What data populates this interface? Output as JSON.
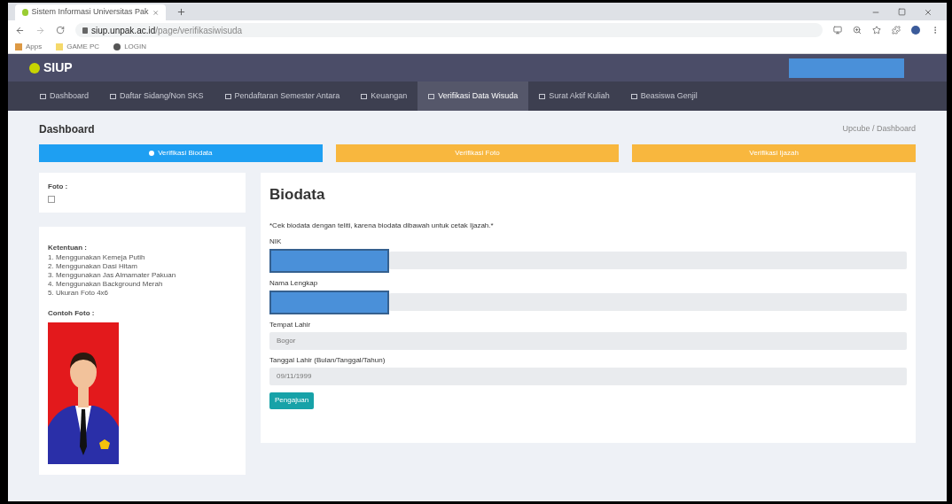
{
  "browser": {
    "tab_title": "Sistem Informasi Universitas Pak",
    "url_host": "siup.unpak.ac.id",
    "url_path": "/page/verifikasiwisuda",
    "bookmarks": [
      "Apps",
      "GAME PC",
      "LOGIN"
    ]
  },
  "app": {
    "logo": "SIUP",
    "user_redacted": true
  },
  "nav": [
    {
      "label": "Dashboard",
      "selected": false
    },
    {
      "label": "Daftar Sidang/Non SKS",
      "selected": false
    },
    {
      "label": "Pendaftaran Semester Antara",
      "selected": false
    },
    {
      "label": "Keuangan",
      "selected": false
    },
    {
      "label": "Verifikasi Data Wisuda",
      "selected": true
    },
    {
      "label": "Surat Aktif Kuliah",
      "selected": false
    },
    {
      "label": "Beasiswa Genjil",
      "selected": false
    }
  ],
  "page_title": "Dashboard",
  "breadcrumb": "Upcube / Dashboard",
  "steps": [
    {
      "label": "Verifikasi Biodata",
      "selected": true
    },
    {
      "label": "Verifikasi Foto",
      "selected": false
    },
    {
      "label": "Verifikasi Ijazah",
      "selected": false
    }
  ],
  "photo_card": {
    "label": "Foto :"
  },
  "rules": {
    "title": "Ketentuan :",
    "items": [
      "1. Menggunakan Kemeja Putih",
      "2. Menggunakan Dasi Hitam",
      "3. Menggunakan Jas Almamater Pakuan",
      "4. Menggunakan Background Merah",
      "5. Ukuran Foto 4x6"
    ],
    "example_label": "Contoh Foto :"
  },
  "form": {
    "title": "Biodata",
    "note": "*Cek biodata dengan teliti, karena biodata dibawah untuk cetak Ijazah.*",
    "fields": [
      {
        "label": "NIK",
        "redacted": true
      },
      {
        "label": "Nama Lengkap",
        "redacted": true
      },
      {
        "label": "Tempat Lahir",
        "value": "Bogor"
      },
      {
        "label": "Tanggal Lahir (Bulan/Tanggal/Tahun)",
        "value": "09/11/1999"
      }
    ],
    "submit": "Pengajuan"
  }
}
